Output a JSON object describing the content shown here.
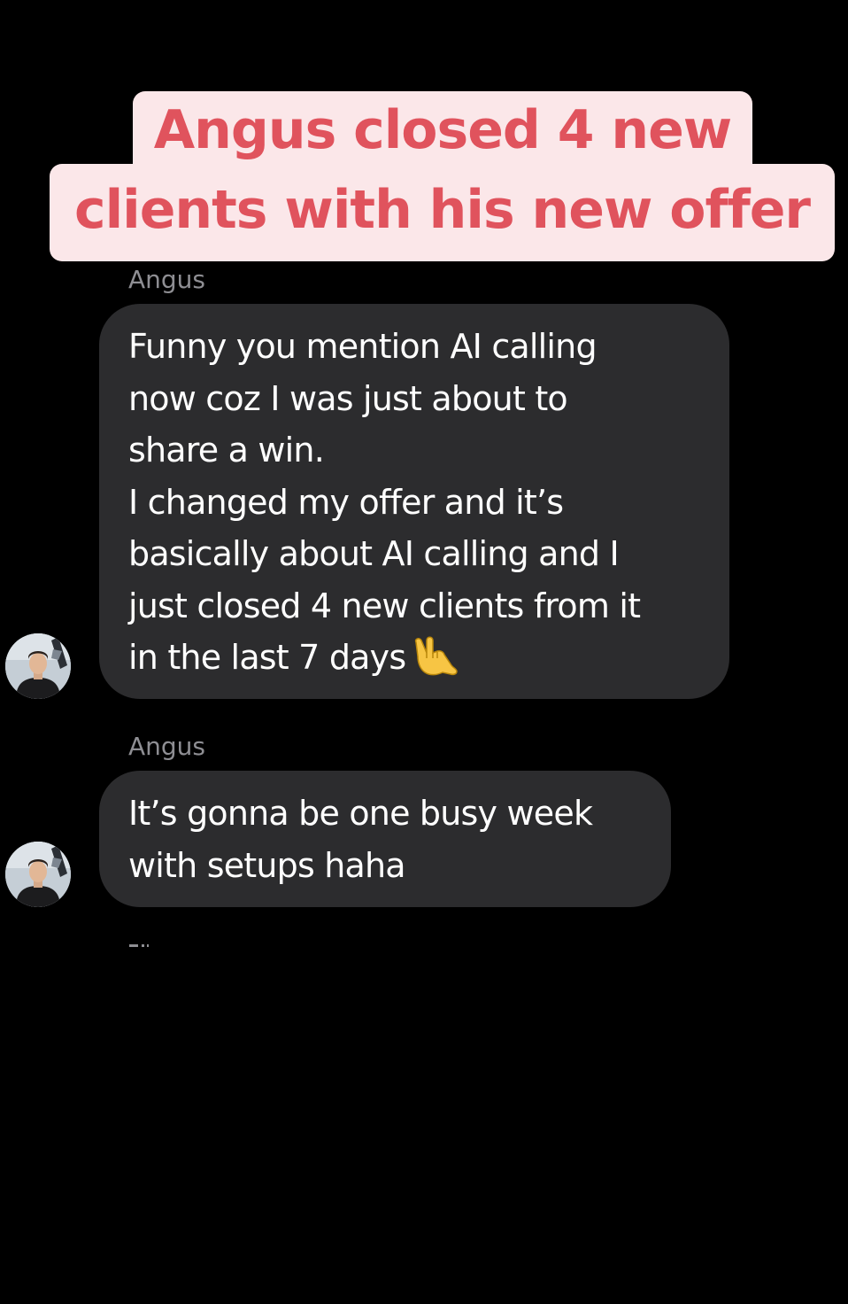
{
  "caption": {
    "line1": "Angus closed 4 new",
    "line2": "clients with his new offer",
    "background_color": "#fbe7e9",
    "text_color": "#e0535d"
  },
  "messages": [
    {
      "sender": "Angus",
      "lines": [
        "Funny you mention AI calling",
        "now coz I was just about to",
        "share a win.",
        "I changed my offer and it’s",
        "basically about AI calling and I",
        "just closed 4 new clients from it",
        "in the last 7 days"
      ],
      "emoji": "call-me-hand-icon"
    },
    {
      "sender": "Angus",
      "lines": [
        "It’s gonna be one busy week",
        "with setups haha"
      ]
    }
  ],
  "colors": {
    "background": "#000000",
    "bubble": "#2c2c2e",
    "sender_label": "#8e8e93",
    "message_text": "#ffffff"
  }
}
